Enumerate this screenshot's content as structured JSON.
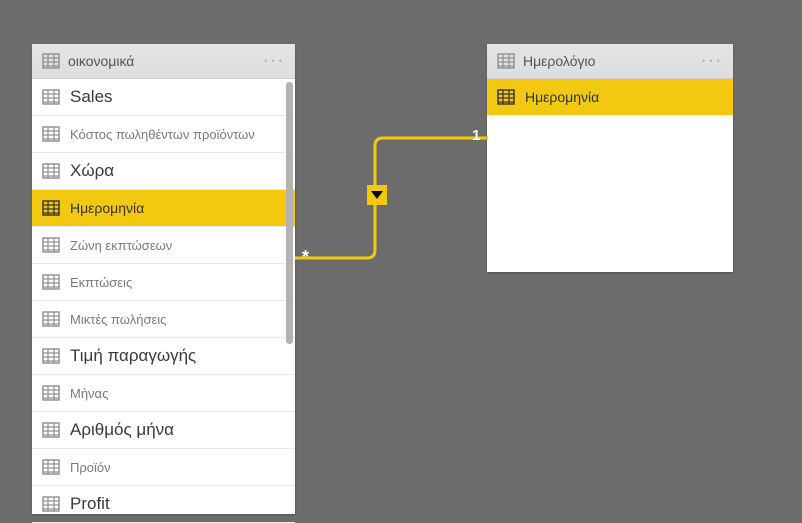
{
  "canvas": {
    "bg": "#6c6c6c"
  },
  "tables": {
    "economics": {
      "title": "οικονομικά",
      "fields": [
        {
          "label": "Sales",
          "variant": "large",
          "selected": false
        },
        {
          "label": "Κόστος πωληθέντων προϊόντων",
          "variant": "muted",
          "selected": false
        },
        {
          "label": "Χώρα",
          "variant": "large",
          "selected": false
        },
        {
          "label": "Ημερομηνία",
          "variant": "normal",
          "selected": true
        },
        {
          "label": "Ζώνη εκπτώσεων",
          "variant": "muted",
          "selected": false
        },
        {
          "label": "Εκπτώσεις",
          "variant": "muted",
          "selected": false
        },
        {
          "label": "Μικτές πωλήσεις",
          "variant": "muted",
          "selected": false
        },
        {
          "label": "Τιμή παραγωγής",
          "variant": "large",
          "selected": false
        },
        {
          "label": "Μήνας",
          "variant": "muted",
          "selected": false
        },
        {
          "label": "Αριθμός μήνα",
          "variant": "large",
          "selected": false
        },
        {
          "label": "Προϊόν",
          "variant": "muted",
          "selected": false
        },
        {
          "label": "Profit",
          "variant": "large",
          "selected": false
        }
      ]
    },
    "calendar": {
      "title": "Ημερολόγιο",
      "fields": [
        {
          "label": "Ημερομηνία",
          "variant": "normal",
          "selected": true
        }
      ]
    }
  },
  "relationship": {
    "from_cardinality": "*",
    "to_cardinality": "1",
    "direction": "single"
  }
}
